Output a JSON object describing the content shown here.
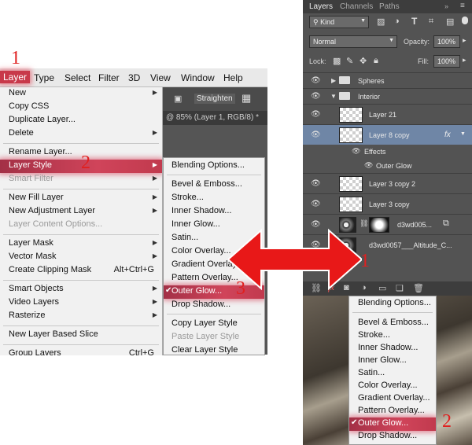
{
  "menubar": {
    "items": [
      "Layer",
      "Type",
      "Select",
      "Filter",
      "3D",
      "View",
      "Window",
      "Help"
    ],
    "active": "Layer"
  },
  "options_bar": {
    "straighten_label": "Straighten"
  },
  "doc_tab": "@ 85% (Layer 1, RGB/8) *",
  "layer_menu": {
    "items": [
      {
        "label": "New",
        "submenu": true
      },
      {
        "label": "Copy CSS"
      },
      {
        "label": "Duplicate Layer..."
      },
      {
        "label": "Delete",
        "submenu": true
      },
      {
        "label": "Rename Layer..."
      },
      {
        "label": "Layer Style",
        "submenu": true,
        "highlighted": true
      },
      {
        "label": "Smart Filter",
        "submenu": true,
        "disabled": true
      },
      {
        "label": "New Fill Layer",
        "submenu": true
      },
      {
        "label": "New Adjustment Layer",
        "submenu": true
      },
      {
        "label": "Layer Content Options...",
        "disabled": true
      },
      {
        "label": "Layer Mask",
        "submenu": true
      },
      {
        "label": "Vector Mask",
        "submenu": true
      },
      {
        "label": "Create Clipping Mask",
        "shortcut": "Alt+Ctrl+G"
      },
      {
        "label": "Smart Objects",
        "submenu": true
      },
      {
        "label": "Video Layers",
        "submenu": true
      },
      {
        "label": "Rasterize",
        "submenu": true
      },
      {
        "label": "New Layer Based Slice"
      },
      {
        "label": "Group Layers",
        "shortcut": "Ctrl+G"
      }
    ]
  },
  "style_submenu": {
    "items": [
      {
        "label": "Blending Options..."
      },
      {
        "label": "Bevel & Emboss..."
      },
      {
        "label": "Stroke..."
      },
      {
        "label": "Inner Shadow..."
      },
      {
        "label": "Inner Glow..."
      },
      {
        "label": "Satin..."
      },
      {
        "label": "Color Overlay..."
      },
      {
        "label": "Gradient Overlay..."
      },
      {
        "label": "Pattern Overlay..."
      },
      {
        "label": "Outer Glow...",
        "checked": true,
        "highlighted": true
      },
      {
        "label": "Drop Shadow..."
      },
      {
        "label": "Copy Layer Style"
      },
      {
        "label": "Paste Layer Style",
        "disabled": true
      },
      {
        "label": "Clear Layer Style"
      }
    ]
  },
  "layers_panel": {
    "tabs": [
      "Layers",
      "Channels",
      "Paths"
    ],
    "kind_label": "Kind",
    "blend_mode": "Normal",
    "opacity_label": "Opacity:",
    "opacity_value": "100%",
    "lock_label": "Lock:",
    "fill_label": "Fill:",
    "fill_value": "100%",
    "layers": [
      {
        "name": "Spheres",
        "type": "group-closed"
      },
      {
        "name": "Interior",
        "type": "group-open"
      },
      {
        "name": "Layer 21",
        "type": "layer"
      },
      {
        "name": "Layer 8 copy",
        "type": "layer",
        "selected": true,
        "fx": "fx"
      },
      {
        "name": "Effects",
        "type": "effects"
      },
      {
        "name": "Outer Glow",
        "type": "effect"
      },
      {
        "name": "Layer 3 copy 2",
        "type": "layer"
      },
      {
        "name": "Layer 3 copy",
        "type": "layer"
      },
      {
        "name": "d3wd005...",
        "type": "smart"
      },
      {
        "name": "d3wd0057___Altitude_C...",
        "type": "photo"
      }
    ],
    "fx_button": "fx"
  },
  "fx_menu": {
    "items": [
      {
        "label": "Blending Options..."
      },
      {
        "label": "Bevel & Emboss..."
      },
      {
        "label": "Stroke..."
      },
      {
        "label": "Inner Shadow..."
      },
      {
        "label": "Inner Glow..."
      },
      {
        "label": "Satin..."
      },
      {
        "label": "Color Overlay..."
      },
      {
        "label": "Gradient Overlay..."
      },
      {
        "label": "Pattern Overlay..."
      },
      {
        "label": "Outer Glow...",
        "checked": true,
        "highlighted": true
      },
      {
        "label": "Drop Shadow..."
      }
    ]
  },
  "annotations": {
    "left_step1": "1",
    "left_step2": "2",
    "left_step3": "3",
    "right_step1": "1",
    "right_step2": "2"
  },
  "colors": {
    "highlight": "#c8394a",
    "annotation": "#e02020",
    "panel": "#535353",
    "selected_layer": "#6f86a6"
  }
}
